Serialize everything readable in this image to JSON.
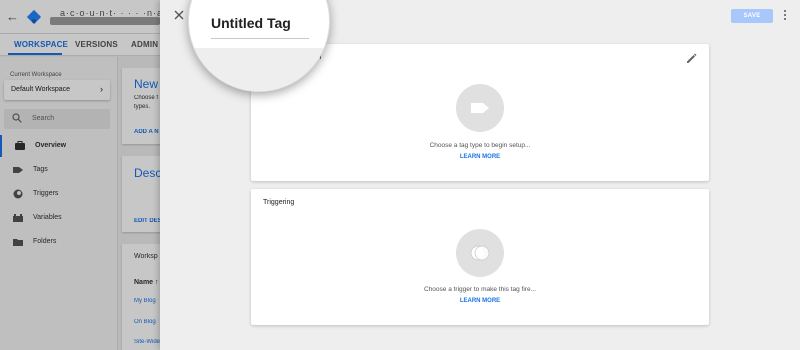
{
  "topbar": {
    "back_icon": "arrow-back-icon",
    "logo_icon": "gtm-logo-icon",
    "account_name": "a·c·o·u·n·t· · · ·  ·n·a·m·e"
  },
  "nav_tabs": [
    {
      "label": "WORKSPACE",
      "active": true
    },
    {
      "label": "VERSIONS",
      "active": false
    },
    {
      "label": "ADMIN",
      "active": false
    }
  ],
  "sidebar": {
    "current_workspace_label": "Current Workspace",
    "workspace_name": "Default Workspace",
    "search_placeholder": "Search",
    "items": [
      {
        "label": "Overview",
        "icon": "briefcase-icon",
        "active": true
      },
      {
        "label": "Tags",
        "icon": "tag-icon",
        "active": false
      },
      {
        "label": "Triggers",
        "icon": "trigger-icon",
        "active": false
      },
      {
        "label": "Variables",
        "icon": "variables-icon",
        "active": false
      },
      {
        "label": "Folders",
        "icon": "folder-icon",
        "active": false
      }
    ]
  },
  "background_cards": {
    "new_card": {
      "title": "New",
      "text": "Choose f",
      "text2": "types.",
      "link": "ADD A N"
    },
    "desc_card": {
      "title": "Desc",
      "link": "EDIT DES"
    },
    "ws_card": {
      "title": "Worksp",
      "col": "Name ↑",
      "rows": [
        "My Blog",
        "On Blog",
        "Site-Wide"
      ]
    }
  },
  "panel": {
    "title": "Untitled Tag",
    "close_icon": "close-icon",
    "save_label": "SAVE",
    "more_icon": "more-vert-icon",
    "config_partial_title": "uration",
    "tag_config": {
      "edit_icon": "pencil-icon",
      "icon": "tag-icon",
      "helper": "Choose a tag type to begin setup...",
      "link": "LEARN MORE"
    },
    "triggering": {
      "title": "Triggering",
      "icon": "trigger-icon",
      "helper": "Choose a trigger to make this tag fire...",
      "link": "LEARN MORE"
    }
  },
  "colors": {
    "accent": "#1a73e8",
    "save_disabled": "#a8c7fa",
    "panel_bg": "#eeeeee"
  }
}
